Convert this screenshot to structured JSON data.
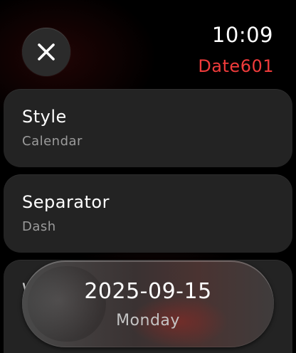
{
  "header": {
    "time": "10:09",
    "app_title": "Date601",
    "close_icon": "close-icon"
  },
  "settings": [
    {
      "label": "Style",
      "value": "Calendar"
    },
    {
      "label": "Separator",
      "value": "Dash"
    },
    {
      "label": "W",
      "value": ""
    }
  ],
  "date_display": {
    "date": "2025-09-15",
    "day": "Monday"
  },
  "colors": {
    "accent": "#f03b3b",
    "row_background": "#232323",
    "secondary_text": "#9b9b9b"
  }
}
